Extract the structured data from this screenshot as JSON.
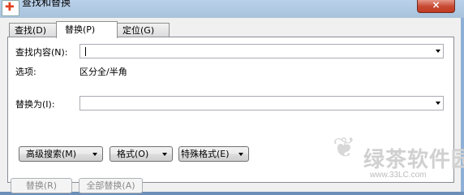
{
  "window": {
    "title": "查找和替换",
    "close_label": "×"
  },
  "tabs": [
    {
      "label": "查找(D)"
    },
    {
      "label": "替换(P)"
    },
    {
      "label": "定位(G)"
    }
  ],
  "find": {
    "label": "查找内容(N):",
    "value": ""
  },
  "options": {
    "label": "选项:",
    "value": "区分全/半角"
  },
  "replace": {
    "label": "替换为(I):",
    "value": ""
  },
  "buttons": {
    "advanced_search": "高级搜索(M)",
    "format": "格式(O)",
    "special_format": "特殊格式(E)",
    "replace": "替换(R)",
    "replace_all": "全部替换(A)"
  },
  "watermark": {
    "text": "绿茶软件园",
    "url": "www.33LC.com"
  }
}
